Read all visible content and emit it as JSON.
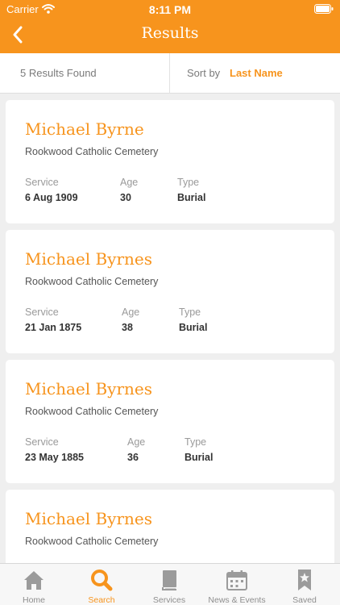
{
  "status_bar": {
    "carrier": "Carrier",
    "time": "8:11 PM"
  },
  "header": {
    "title": "Results"
  },
  "sort_bar": {
    "count": "5 Results Found",
    "sort_label": "Sort by",
    "sort_value": "Last Name"
  },
  "results": [
    {
      "name": "Michael Byrne",
      "cemetery": "Rookwood Catholic Cemetery",
      "service_label": "Service",
      "service": "6 Aug 1909",
      "age_label": "Age",
      "age": "30",
      "type_label": "Type",
      "type": "Burial"
    },
    {
      "name": "Michael Byrnes",
      "cemetery": "Rookwood Catholic Cemetery",
      "service_label": "Service",
      "service": "21 Jan 1875",
      "age_label": "Age",
      "age": "38",
      "type_label": "Type",
      "type": "Burial"
    },
    {
      "name": "Michael Byrnes",
      "cemetery": "Rookwood Catholic Cemetery",
      "service_label": "Service",
      "service": "23 May 1885",
      "age_label": "Age",
      "age": "36",
      "type_label": "Type",
      "type": "Burial"
    },
    {
      "name": "Michael Byrnes",
      "cemetery": "Rookwood Catholic Cemetery"
    }
  ],
  "tabs": [
    {
      "label": "Home",
      "icon": "home-icon",
      "active": false
    },
    {
      "label": "Search",
      "icon": "search-icon",
      "active": true
    },
    {
      "label": "Services",
      "icon": "book-icon",
      "active": false
    },
    {
      "label": "News & Events",
      "icon": "calendar-icon",
      "active": false
    },
    {
      "label": "Saved",
      "icon": "bookmark-star-icon",
      "active": false
    }
  ],
  "colors": {
    "accent": "#f7941d",
    "tab_inactive": "#8e8e8e"
  }
}
